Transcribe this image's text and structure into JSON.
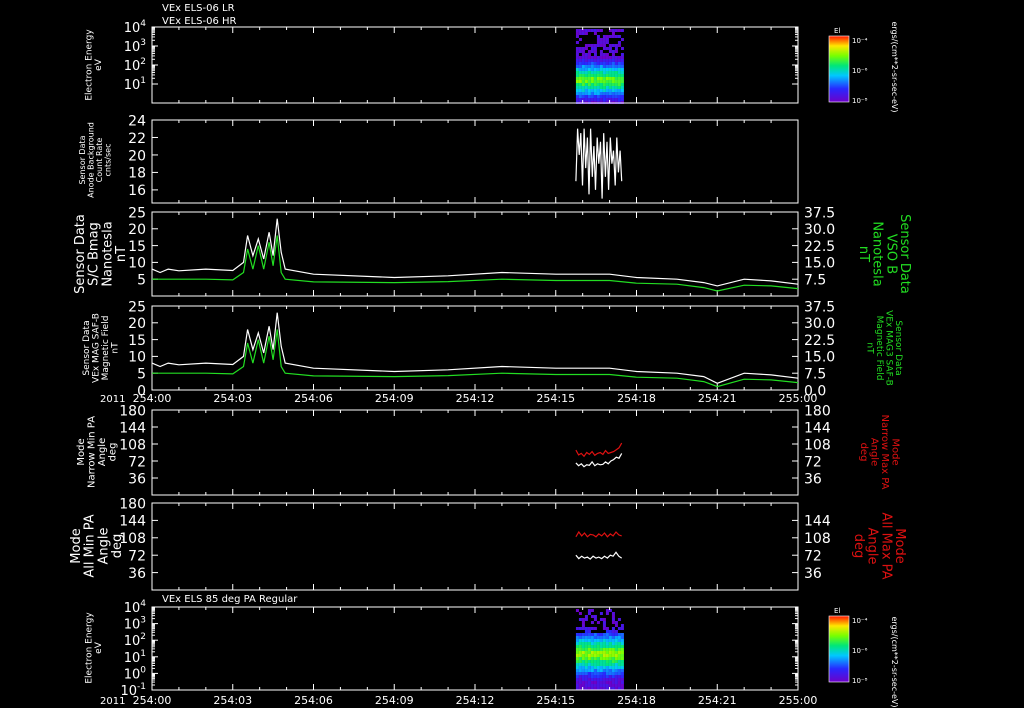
{
  "header": {
    "line1": "VEx ELS-06 LR",
    "line2": "VEx ELS-06 HR"
  },
  "time_axis": {
    "year": "2011",
    "ticks": [
      "254:00",
      "254:03",
      "254:06",
      "254:09",
      "254:12",
      "254:15",
      "254:18",
      "254:21",
      "255:00"
    ]
  },
  "colors": {
    "background": "#000000",
    "axes": "#ffffff",
    "trace_white": "#ffffff",
    "trace_green": "#22dd22",
    "trace_red": "#dd1111"
  },
  "chart_data": [
    {
      "type": "heatmap",
      "panel": "electron-energy-1",
      "ylabel": [
        "Electron Energy",
        "eV"
      ],
      "y_scale": "log",
      "ylim": [
        1,
        10000
      ],
      "y_ticks": [
        {
          "base": "10",
          "exp": "4"
        },
        {
          "base": "10",
          "exp": "3"
        },
        {
          "base": "10",
          "exp": "2"
        },
        {
          "base": "10",
          "exp": "1"
        }
      ],
      "colorbar": {
        "title": "El",
        "tick_labels": [
          "10⁻⁴",
          "10⁻⁶",
          "10⁻⁸"
        ],
        "unit": "ergs/(cm**2-sr-sec-eV)"
      },
      "data_span": [
        "254:15.7",
        "254:17.5"
      ]
    },
    {
      "type": "line",
      "panel": "anode-background",
      "ylabel": [
        "Sensor Data",
        "Anode Background",
        "Count Rate",
        "cnts/sec"
      ],
      "ylim": [
        14.5,
        24
      ],
      "y_ticks": [
        "24",
        "22",
        "20",
        "18",
        "16"
      ],
      "series": [
        {
          "color": "white",
          "x_start": 15.75,
          "x_end": 17.45,
          "values": [
            17,
            23,
            20,
            22.5,
            16.5,
            23,
            18.5,
            22,
            15.5,
            23,
            17.5,
            21,
            16,
            22,
            19,
            21.5,
            15,
            22.5,
            17.5,
            21.5,
            16,
            22,
            19,
            20.5,
            16.5,
            22,
            18,
            20.5,
            17
          ]
        }
      ]
    },
    {
      "type": "line",
      "panel": "sc-bmag",
      "ylabel": [
        "Sensor Data",
        "S/C Bmag",
        "Nanotesla",
        "nT"
      ],
      "ylabel_right": [
        "Sensor Data",
        "VSO B",
        "Nanotesla",
        "nT"
      ],
      "ylim": [
        0,
        25
      ],
      "y_ticks": [
        "25",
        "20",
        "15",
        "10",
        "5"
      ],
      "y_ticks_right": [
        "37.5",
        "30.0",
        "22.5",
        "15.0",
        "7.5"
      ],
      "series": [
        {
          "color": "white",
          "values": [
            [
              0,
              8
            ],
            [
              0.3,
              7
            ],
            [
              0.6,
              8
            ],
            [
              1,
              7.5
            ],
            [
              2,
              8
            ],
            [
              3,
              7.6
            ],
            [
              3.4,
              10
            ],
            [
              3.55,
              18
            ],
            [
              3.75,
              12
            ],
            [
              3.95,
              17
            ],
            [
              4.15,
              11
            ],
            [
              4.35,
              19
            ],
            [
              4.5,
              12
            ],
            [
              4.65,
              23
            ],
            [
              4.8,
              13
            ],
            [
              4.95,
              8
            ],
            [
              6,
              6.5
            ],
            [
              9,
              5.5
            ],
            [
              11,
              6
            ],
            [
              13,
              7
            ],
            [
              15,
              6.5
            ],
            [
              17,
              6.5
            ],
            [
              18,
              5.5
            ],
            [
              19.5,
              5
            ],
            [
              20.5,
              4
            ],
            [
              21,
              3
            ],
            [
              22,
              5
            ],
            [
              23,
              4.5
            ],
            [
              24,
              3.5
            ]
          ]
        },
        {
          "color": "green",
          "values": [
            [
              0,
              5
            ],
            [
              2,
              5
            ],
            [
              3,
              4.8
            ],
            [
              3.4,
              7
            ],
            [
              3.55,
              14
            ],
            [
              3.75,
              8
            ],
            [
              3.95,
              15
            ],
            [
              4.15,
              8
            ],
            [
              4.35,
              16
            ],
            [
              4.5,
              9
            ],
            [
              4.65,
              18
            ],
            [
              4.8,
              7
            ],
            [
              4.95,
              5
            ],
            [
              6,
              4.2
            ],
            [
              9,
              4
            ],
            [
              11,
              4.3
            ],
            [
              13,
              5
            ],
            [
              15,
              4.6
            ],
            [
              17,
              4.6
            ],
            [
              18,
              3.8
            ],
            [
              19.5,
              3.5
            ],
            [
              20.5,
              2.5
            ],
            [
              21,
              1.5
            ],
            [
              22,
              3.2
            ],
            [
              23,
              3
            ],
            [
              24,
              2.2
            ]
          ]
        }
      ]
    },
    {
      "type": "line",
      "panel": "mag-saf-b",
      "ylabel": [
        "Sensor Data",
        "VEx MAG SAF-B",
        "Magnetic Field",
        "nT"
      ],
      "ylabel_right": [
        "Sensor Data",
        "VEx MAG3 SAF-B",
        "Magnetic Field",
        "nT"
      ],
      "ylim": [
        0,
        25
      ],
      "y_ticks": [
        "25",
        "20",
        "15",
        "10",
        "5",
        "0"
      ],
      "y_ticks_right": [
        "37.5",
        "30.0",
        "22.5",
        "15.0",
        "7.5",
        "0.0"
      ],
      "series": [
        {
          "color": "white",
          "values": [
            [
              0,
              8
            ],
            [
              0.3,
              7
            ],
            [
              0.6,
              8
            ],
            [
              1,
              7.5
            ],
            [
              2,
              8
            ],
            [
              3,
              7.6
            ],
            [
              3.4,
              10
            ],
            [
              3.55,
              18
            ],
            [
              3.75,
              12
            ],
            [
              3.95,
              17
            ],
            [
              4.15,
              11
            ],
            [
              4.35,
              19
            ],
            [
              4.5,
              12
            ],
            [
              4.65,
              23
            ],
            [
              4.8,
              13
            ],
            [
              4.95,
              8
            ],
            [
              6,
              6.5
            ],
            [
              9,
              5.5
            ],
            [
              11,
              6
            ],
            [
              13,
              7
            ],
            [
              15,
              6.5
            ],
            [
              17,
              6.5
            ],
            [
              18,
              5.5
            ],
            [
              19.5,
              5
            ],
            [
              20.5,
              4
            ],
            [
              21,
              2
            ],
            [
              22,
              5
            ],
            [
              23,
              4.5
            ],
            [
              24,
              3.5
            ]
          ]
        },
        {
          "color": "green",
          "values": [
            [
              0,
              5
            ],
            [
              2,
              5
            ],
            [
              3,
              4.8
            ],
            [
              3.4,
              7
            ],
            [
              3.55,
              14
            ],
            [
              3.75,
              8
            ],
            [
              3.95,
              15
            ],
            [
              4.15,
              8
            ],
            [
              4.35,
              16
            ],
            [
              4.5,
              9
            ],
            [
              4.65,
              18
            ],
            [
              4.8,
              7
            ],
            [
              4.95,
              5
            ],
            [
              6,
              4.2
            ],
            [
              9,
              4
            ],
            [
              11,
              4.3
            ],
            [
              13,
              5
            ],
            [
              15,
              4.6
            ],
            [
              17,
              4.6
            ],
            [
              18,
              3.8
            ],
            [
              19.5,
              3.5
            ],
            [
              20.5,
              2.5
            ],
            [
              21,
              1
            ],
            [
              22,
              3.2
            ],
            [
              23,
              3
            ],
            [
              24,
              2.2
            ]
          ]
        }
      ]
    },
    {
      "type": "line",
      "panel": "narrow-pa",
      "ylabel": [
        "Mode",
        "Narrow Min PA",
        "Angle",
        "deg"
      ],
      "ylabel_right": [
        "Mode",
        "Narrow Max PA",
        "Angle",
        "deg"
      ],
      "ylim": [
        0,
        180
      ],
      "y_ticks": [
        "180",
        "144",
        "108",
        "72",
        "36"
      ],
      "y_ticks_right": [
        "180",
        "144",
        "108",
        "72",
        "36"
      ],
      "series": [
        {
          "color": "red",
          "x_start": 15.75,
          "x_end": 17.45,
          "values": [
            95,
            85,
            88,
            82,
            90,
            86,
            92,
            84,
            88,
            90,
            86,
            94,
            88,
            90,
            92,
            96,
            100,
            110
          ]
        },
        {
          "color": "white",
          "x_start": 15.75,
          "x_end": 17.45,
          "values": [
            68,
            62,
            66,
            60,
            64,
            63,
            70,
            62,
            66,
            64,
            65,
            70,
            66,
            72,
            75,
            80,
            78,
            88
          ]
        }
      ]
    },
    {
      "type": "line",
      "panel": "all-pa",
      "ylabel": [
        "Mode",
        "All Min PA",
        "Angle",
        "deg"
      ],
      "ylabel_right": [
        "Mode",
        "All Max PA",
        "Angle",
        "deg"
      ],
      "ylim": [
        0,
        180
      ],
      "y_ticks": [
        "180",
        "144",
        "108",
        "72",
        "36"
      ],
      "y_ticks_right": [
        "144",
        "108",
        "72",
        "36"
      ],
      "series": [
        {
          "color": "red",
          "x_start": 15.75,
          "x_end": 17.45,
          "values": [
            110,
            120,
            112,
            118,
            110,
            115,
            114,
            110,
            116,
            112,
            118,
            110,
            116,
            112,
            120,
            114,
            112
          ]
        },
        {
          "color": "white",
          "x_start": 15.75,
          "x_end": 17.45,
          "values": [
            72,
            65,
            70,
            66,
            68,
            64,
            70,
            66,
            68,
            65,
            70,
            66,
            72,
            70,
            78,
            70,
            66
          ]
        }
      ]
    },
    {
      "type": "heatmap",
      "panel": "electron-energy-2",
      "title": "VEx ELS 85 deg PA Regular",
      "ylabel": [
        "Electron Energy",
        "eV"
      ],
      "y_scale": "log",
      "ylim": [
        0.1,
        10000
      ],
      "y_ticks": [
        {
          "base": "10",
          "exp": "4"
        },
        {
          "base": "10",
          "exp": "3"
        },
        {
          "base": "10",
          "exp": "2"
        },
        {
          "base": "10",
          "exp": "1"
        },
        {
          "base": "10",
          "exp": "0"
        },
        {
          "base": "10",
          "exp": "-1"
        }
      ],
      "colorbar": {
        "title": "El",
        "tick_labels": [
          "10⁻⁴",
          "10⁻⁶",
          "10⁻⁸"
        ],
        "unit": "ergs/(cm**2-sr-sec-eV)"
      },
      "data_span": [
        "254:15.7",
        "254:17.5"
      ]
    }
  ]
}
